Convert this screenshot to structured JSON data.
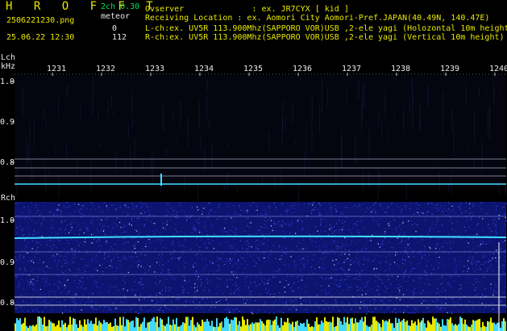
{
  "header": {
    "logo": "H R O F F T",
    "channels": "2ch 0.30",
    "filename": "2506221230.png",
    "meteor_label": "meteor",
    "lch_count": "0",
    "rch_count": "112",
    "datetime": "25.06.22 12:30",
    "observer": "Ovserver              : ex. JR7CYX [ kid ]",
    "location": "Receiving Location : ex. Aomori City Aomori-Pref.JAPAN(40.49N, 140.47E)",
    "lch_info": "L-ch:ex. UV5R 113.900Mhz(SAPPORO VOR)USB ,2-ele yagi (Holozontal 10m height",
    "rch_info": "R-ch:ex. UV5R 113.900Mhz(SAPPORO VOR)USB ,2-ele yagi (Vertical 10m height)"
  },
  "axis": {
    "lch_label": "Lch",
    "khz_label": "kHz",
    "rch_label": "Rch",
    "time_ticks": [
      "1231",
      "1232",
      "1233",
      "1234",
      "1235",
      "1236",
      "1237",
      "1238",
      "1239",
      "1240"
    ],
    "lch_freq_ticks": [
      "1.0",
      "0.9",
      "0.8"
    ],
    "rch_freq_ticks": [
      "1.0",
      "0.9",
      "0.8"
    ]
  },
  "colors": {
    "background": "#000000",
    "header_yellow": "#e8e800",
    "info_green": "#00e060",
    "waterfall_blue": "#1a2ab8",
    "signal_cyan": "#40e0ff",
    "meteor_bar_yellow": "#e8e800"
  }
}
